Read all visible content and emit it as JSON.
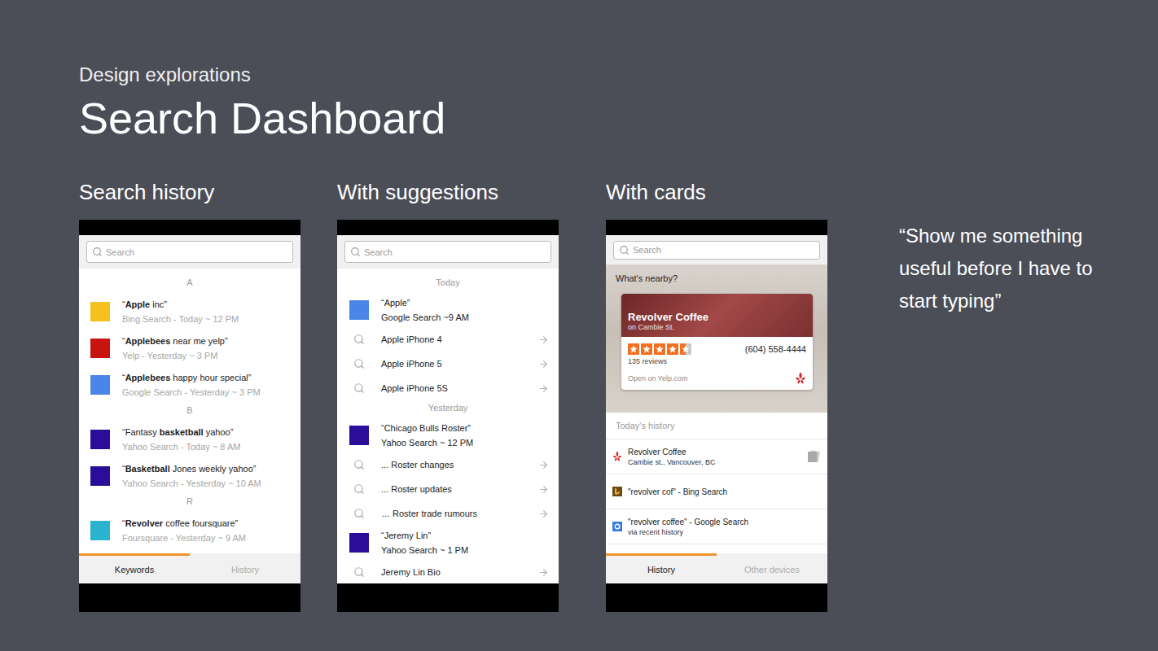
{
  "slide": {
    "eyebrow": "Design explorations",
    "title": "Search Dashboard",
    "quote": "“Show me something useful before I have to start typing”"
  },
  "history_panel": {
    "label": "Search history",
    "search": {
      "placeholder": "Search"
    },
    "groups": [
      {
        "letter": "A",
        "items": [
          {
            "prefix": "“",
            "bold": "Apple",
            "suffix": " inc”",
            "meta": "Bing Search - Today ~ 12 PM",
            "color": "#f4c01e"
          },
          {
            "prefix": "“",
            "bold": "Applebees",
            "suffix": " near me yelp”",
            "meta": "Yelp - Yesterday ~ 3 PM",
            "color": "#c8140e"
          },
          {
            "prefix": "“",
            "bold": "Applebees",
            "suffix": " happy hour special”",
            "meta": "Google Search - Yesterday ~ 3 PM",
            "color": "#4a86e8"
          }
        ]
      },
      {
        "letter": "B",
        "items": [
          {
            "prefix": "“Fantasy ",
            "bold": "basketball",
            "suffix": " yahoo”",
            "meta": "Yahoo Search - Today ~ 8 AM",
            "color": "#2a0e9a"
          },
          {
            "prefix": "“",
            "bold": "Basketball",
            "suffix": " Jones weekly yahoo”",
            "meta": "Yahoo Search - Yesterday ~ 10 AM",
            "color": "#2a0e9a"
          }
        ]
      },
      {
        "letter": "R",
        "items": [
          {
            "prefix": "“",
            "bold": "Revolver",
            "suffix": " coffee foursquare”",
            "meta": "Foursquare - Yesterday ~ 9 AM",
            "color": "#2ab2d0"
          }
        ]
      }
    ],
    "tabs": [
      {
        "label": "Keywords",
        "selected": true
      },
      {
        "label": "History",
        "selected": false
      }
    ]
  },
  "suggestions_panel": {
    "label": "With suggestions",
    "search": {
      "placeholder": "Search"
    },
    "groups": [
      {
        "heading": "Today",
        "entries": [
          {
            "kind": "query",
            "title": "“Apple”",
            "meta": "Google Search ~9 AM",
            "color": "#4a86e8"
          },
          {
            "kind": "suggestion",
            "title": "Apple iPhone 4"
          },
          {
            "kind": "suggestion",
            "title": "Apple iPhone 5"
          },
          {
            "kind": "suggestion",
            "title": "Apple iPhone 5S"
          }
        ]
      },
      {
        "heading": "Yesterday",
        "entries": [
          {
            "kind": "query",
            "title": "“Chicago Bulls Roster”",
            "meta": "Yahoo Search ~ 12 PM",
            "color": "#2a0e9a"
          },
          {
            "kind": "suggestion",
            "title": "... Roster changes"
          },
          {
            "kind": "suggestion",
            "title": "... Roster updates"
          },
          {
            "kind": "suggestion",
            "title": "… Roster trade rumours"
          },
          {
            "kind": "query",
            "title": "“Jeremy Lin”",
            "meta": "Yahoo Search ~ 1 PM",
            "color": "#2a0e9a"
          },
          {
            "kind": "suggestion",
            "title": "Jeremy Lin Bio"
          }
        ]
      }
    ]
  },
  "cards_panel": {
    "label": "With cards",
    "search": {
      "placeholder": "Search"
    },
    "nearby": {
      "heading": "What's nearby?",
      "card": {
        "name": "Revolver Coffee",
        "location": "on Cambie St.",
        "stars": 4.5,
        "reviews": "135 reviews",
        "phone": "(604) 558-4444",
        "link": "Open on Yelp.com"
      }
    },
    "history_heading": "Today's history",
    "history": [
      {
        "kind": "yelp",
        "title": "Revolver Coffee",
        "sub": "Cambie st., Vancouver, BC",
        "saved": true
      },
      {
        "kind": "bing",
        "title": "\"revolver cof\" - Bing Search",
        "saved": false
      },
      {
        "kind": "google",
        "title": "\"revolver coffee\" - Google Search",
        "sub": "via recent history",
        "saved": false
      }
    ],
    "tabs": [
      {
        "label": "History",
        "selected": true
      },
      {
        "label": "Other devices",
        "selected": false
      }
    ]
  }
}
